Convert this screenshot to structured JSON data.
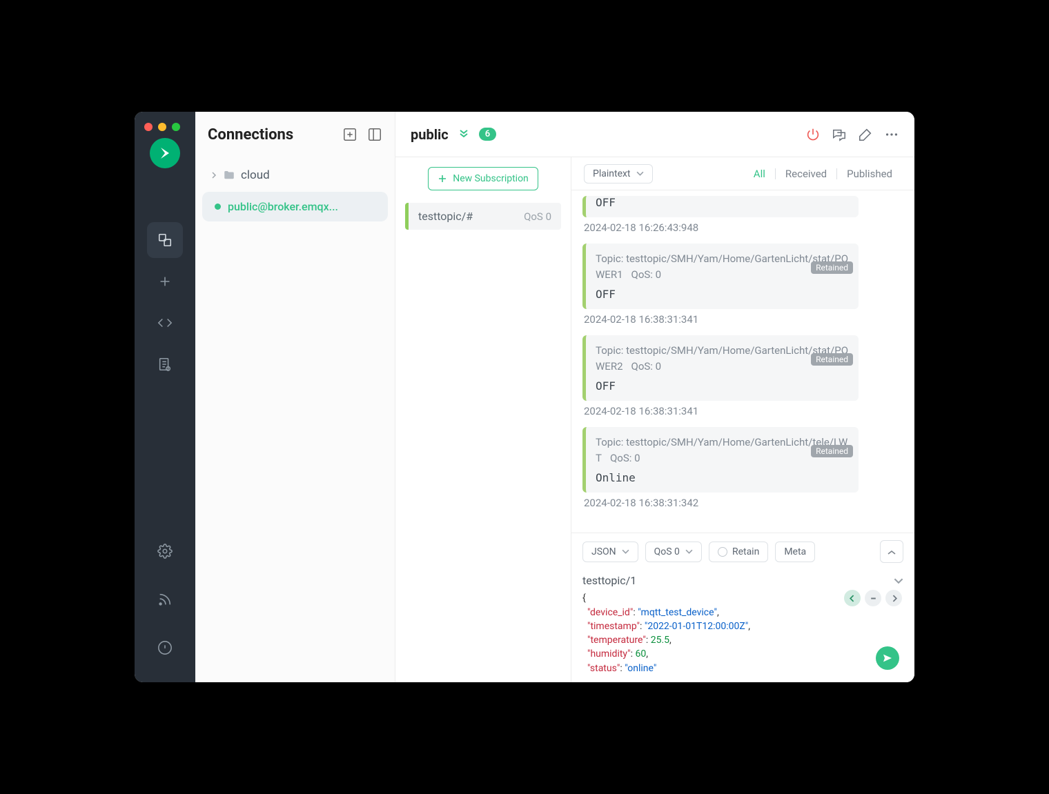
{
  "sidebar_title": "Connections",
  "tree": {
    "group_label": "cloud",
    "conn_item_label": "public@broker.emqx..."
  },
  "header": {
    "conn_name": "public",
    "count": "6"
  },
  "subs": {
    "new_label": "New Subscription",
    "items": [
      {
        "topic": "testtopic/#",
        "qos": "QoS 0"
      }
    ]
  },
  "toolbar": {
    "format_label": "Plaintext",
    "filters": {
      "all": "All",
      "received": "Received",
      "published": "Published"
    }
  },
  "messages": [
    {
      "payload": "OFF",
      "ts": "2024-02-18 16:26:43:948",
      "has_meta": false
    },
    {
      "topic": "testtopic/SMH/Yam/Home/GartenLicht/stat/POWER1",
      "qos": "QoS: 0",
      "retained": "Retained",
      "payload": "OFF",
      "ts": "2024-02-18 16:38:31:341",
      "has_meta": true
    },
    {
      "topic": "testtopic/SMH/Yam/Home/GartenLicht/stat/POWER2",
      "qos": "QoS: 0",
      "retained": "Retained",
      "payload": "OFF",
      "ts": "2024-02-18 16:38:31:341",
      "has_meta": true
    },
    {
      "topic": "testtopic/SMH/Yam/Home/GartenLicht/tele/LWT",
      "qos": "QoS: 0",
      "retained": "Retained",
      "payload": "Online",
      "ts": "2024-02-18 16:38:31:342",
      "has_meta": true
    }
  ],
  "publish": {
    "format": "JSON",
    "qos": "QoS 0",
    "retain": "Retain",
    "meta": "Meta",
    "topic_value": "testtopic/1",
    "payload_lines": [
      {
        "indent": 0,
        "brace": "{"
      },
      {
        "indent": 1,
        "key": "\"device_id\"",
        "sep": ": ",
        "val": "\"mqtt_test_device\"",
        "val_type": "str",
        "comma": ","
      },
      {
        "indent": 1,
        "key": "\"timestamp\"",
        "sep": ": ",
        "val": "\"2022-01-01T12:00:00Z\"",
        "val_type": "str",
        "comma": ","
      },
      {
        "indent": 1,
        "key": "\"temperature\"",
        "sep": ": ",
        "val": "25.5",
        "val_type": "num",
        "comma": ","
      },
      {
        "indent": 1,
        "key": "\"humidity\"",
        "sep": ": ",
        "val": "60",
        "val_type": "num",
        "comma": ","
      },
      {
        "indent": 1,
        "key": "\"status\"",
        "sep": ": ",
        "val": "\"online\"",
        "val_type": "str",
        "comma": ""
      }
    ]
  }
}
